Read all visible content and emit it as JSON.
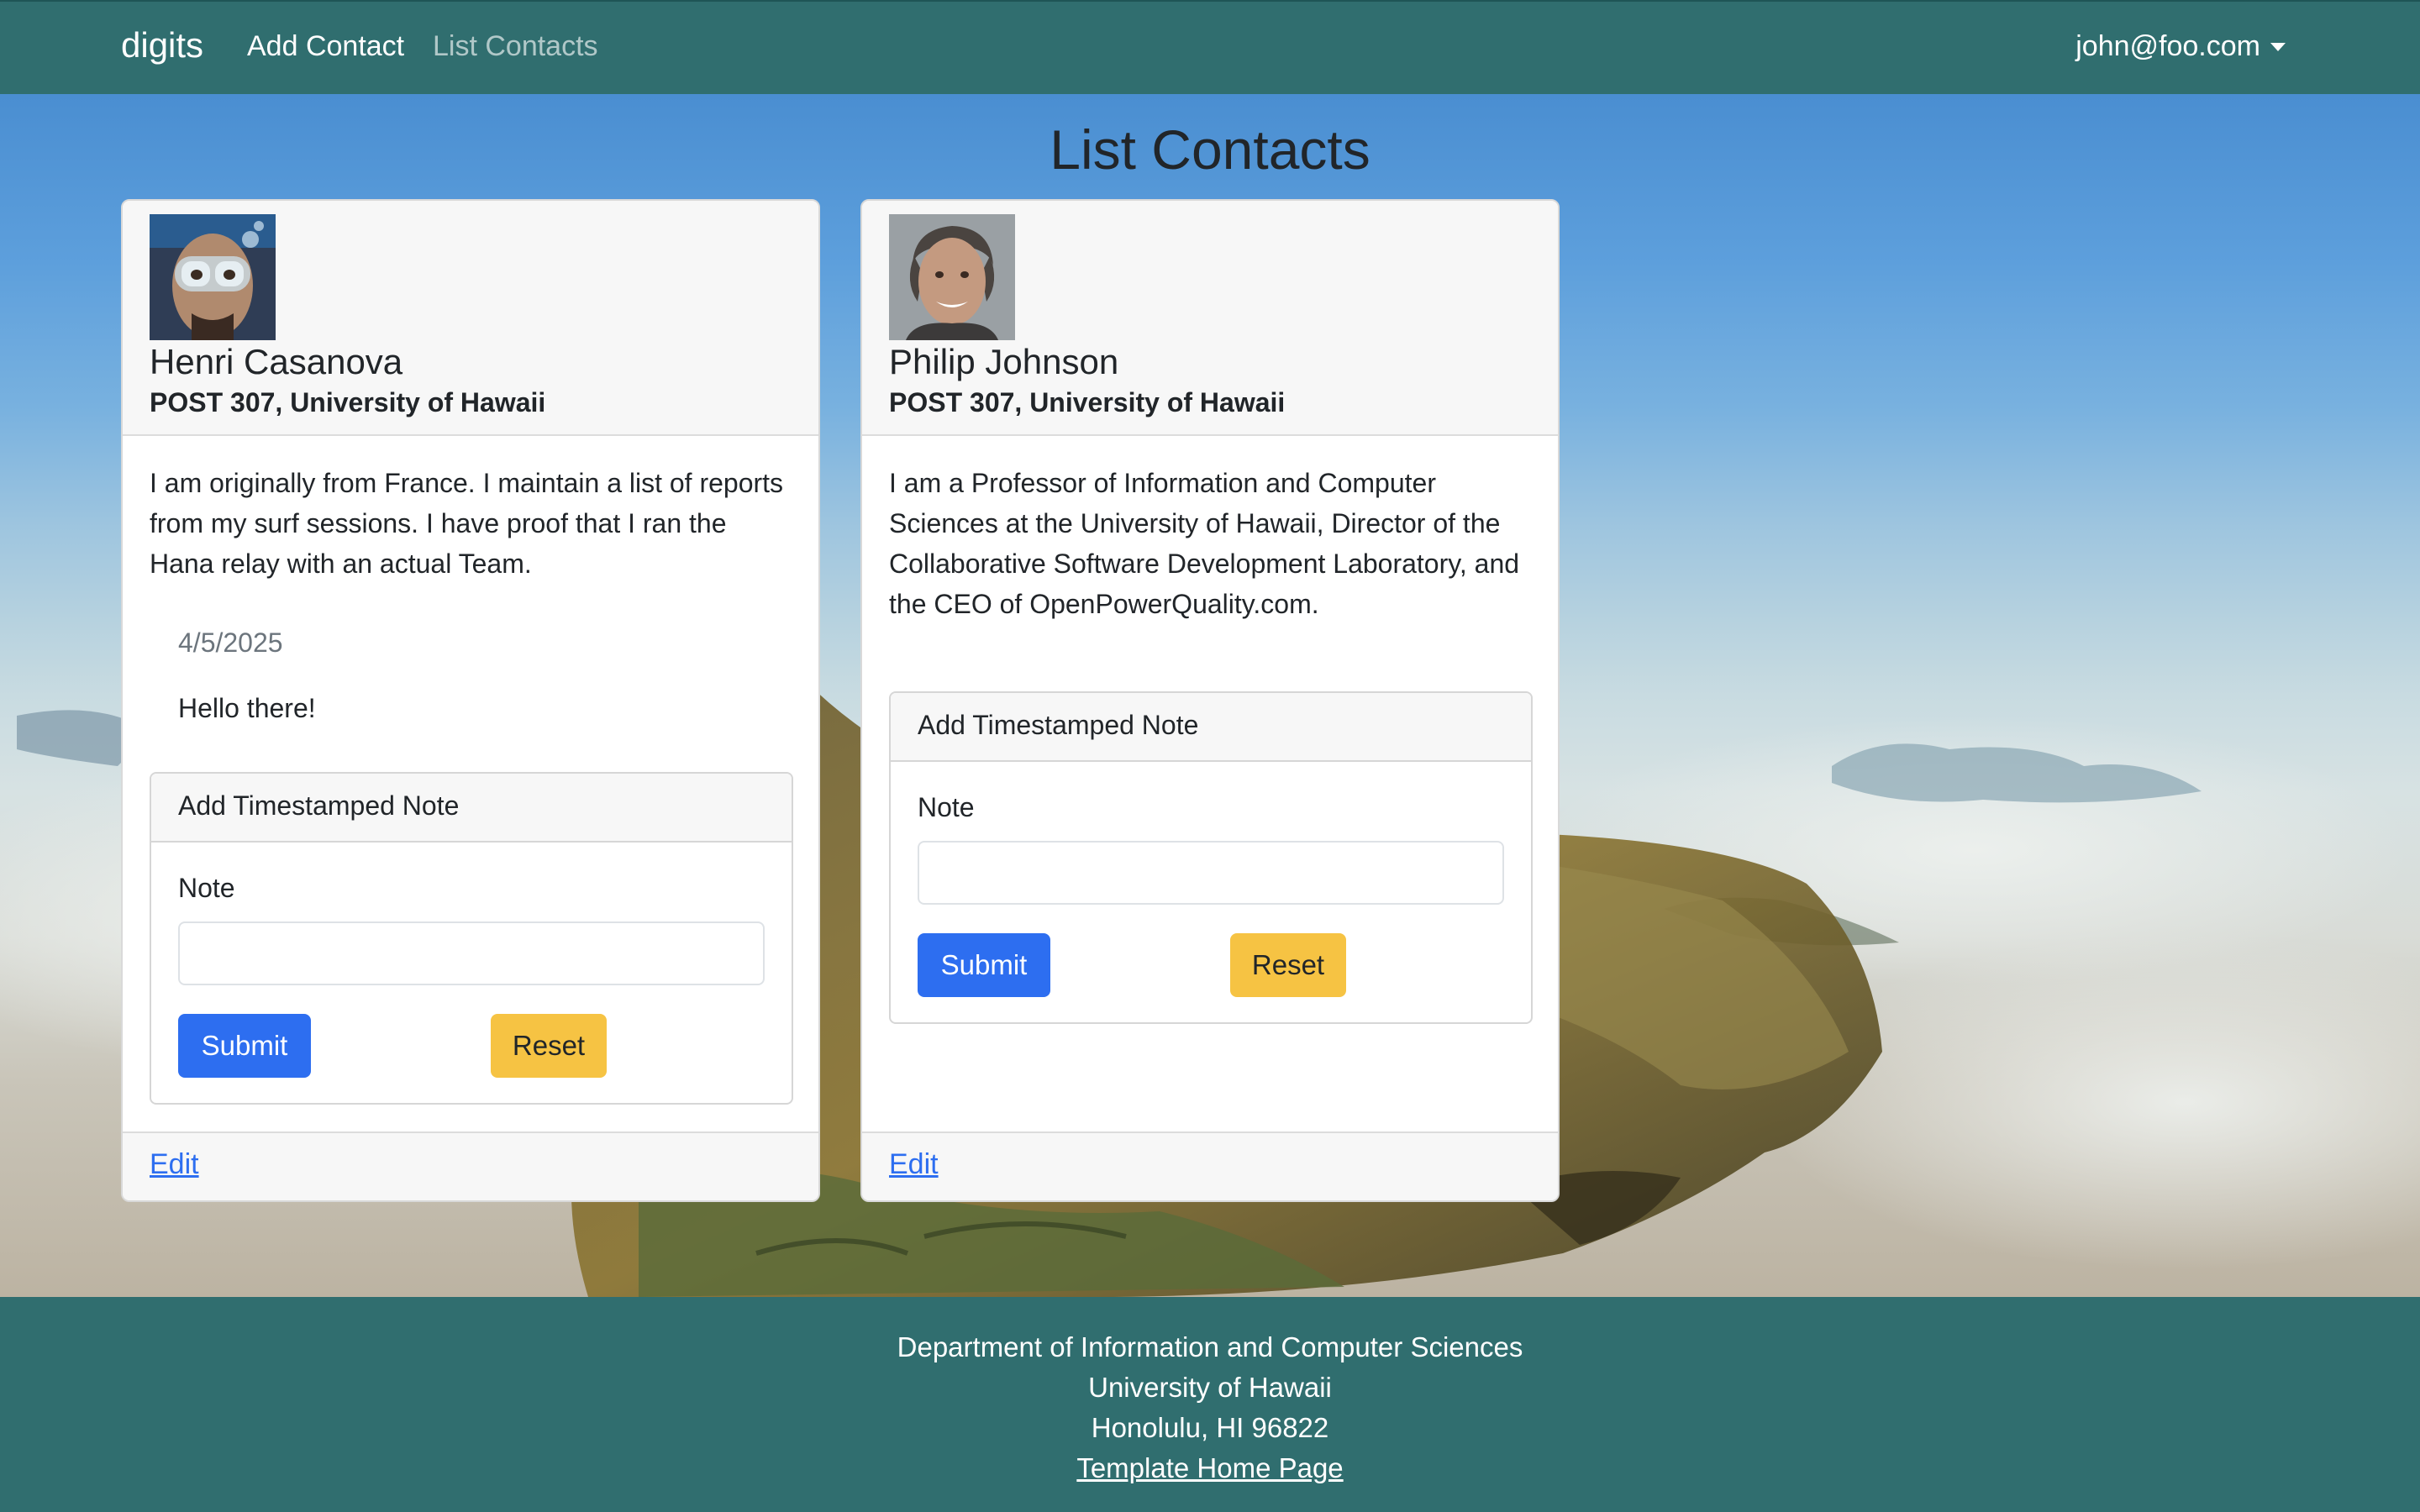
{
  "navbar": {
    "brand": "digits",
    "links": [
      "Add Contact",
      "List Contacts"
    ],
    "user": "john@foo.com"
  },
  "page": {
    "title": "List Contacts"
  },
  "contacts": [
    {
      "name": "Henri Casanova",
      "address": "POST 307, University of Hawaii",
      "description": "I am originally from France. I maintain a list of reports from my surf sessions. I have proof that I ran the Hana relay with an actual Team.",
      "notes": [
        {
          "date": "4/5/2025",
          "text": "Hello there!"
        }
      ],
      "form": {
        "title": "Add Timestamped Note",
        "label": "Note",
        "value": "",
        "submit": "Submit",
        "reset": "Reset"
      },
      "edit": "Edit"
    },
    {
      "name": "Philip Johnson",
      "address": "POST 307, University of Hawaii",
      "description": "I am a Professor of Information and Computer Sciences at the University of Hawaii, Director of the Collaborative Software Development Laboratory, and the CEO of OpenPowerQuality.com.",
      "notes": [],
      "form": {
        "title": "Add Timestamped Note",
        "label": "Note",
        "value": "",
        "submit": "Submit",
        "reset": "Reset"
      },
      "edit": "Edit"
    }
  ],
  "footer": {
    "lines": [
      "Department of Information and Computer Sciences",
      "University of Hawaii",
      "Honolulu, HI 96822"
    ],
    "link": "Template Home Page"
  },
  "colors": {
    "navbar": "#306e6f",
    "primary_button": "#2d6ef0",
    "warning_button": "#f6c343",
    "link": "#2d6ef0"
  }
}
